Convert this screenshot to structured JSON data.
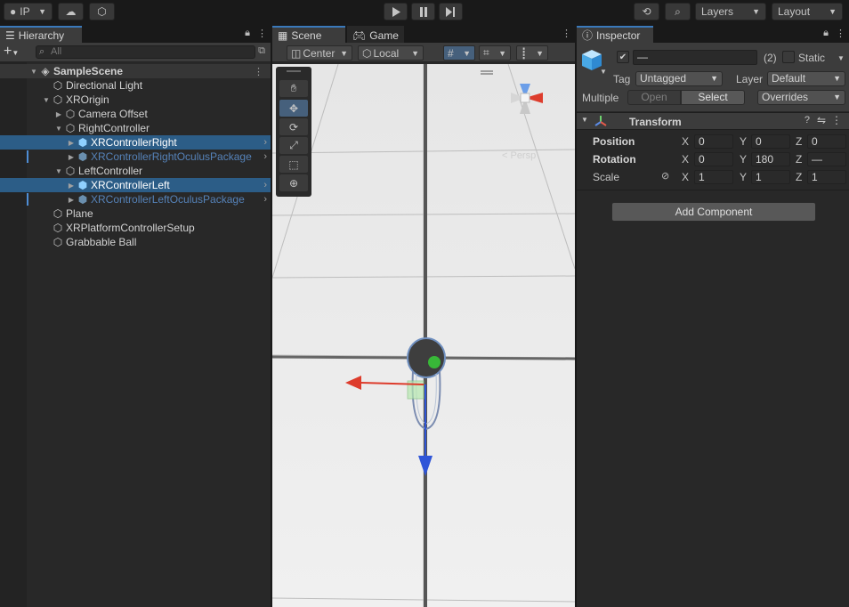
{
  "toolbar": {
    "account_label": "IP",
    "layers_label": "Layers",
    "layout_label": "Layout"
  },
  "hierarchy": {
    "tab_label": "Hierarchy",
    "search_placeholder": "All",
    "items": [
      {
        "label": "SampleScene"
      },
      {
        "label": "Directional Light"
      },
      {
        "label": "XROrigin"
      },
      {
        "label": "Camera Offset"
      },
      {
        "label": "RightController"
      },
      {
        "label": "XRControllerRight"
      },
      {
        "label": "XRControllerRightOculusPackage"
      },
      {
        "label": "LeftController"
      },
      {
        "label": "XRControllerLeft"
      },
      {
        "label": "XRControllerLeftOculusPackage"
      },
      {
        "label": "Plane"
      },
      {
        "label": "XRPlatformControllerSetup"
      },
      {
        "label": "Grabbable Ball"
      }
    ]
  },
  "scene": {
    "tab_scene": "Scene",
    "tab_game": "Game",
    "pivot_label": "Center",
    "space_label": "Local",
    "persp_label": "< Persp"
  },
  "inspector": {
    "tab_label": "Inspector",
    "name_value": "—",
    "count_label": "(2)",
    "static_label": "Static",
    "tag_label": "Tag",
    "tag_value": "Untagged",
    "layer_label": "Layer",
    "layer_value": "Default",
    "multiple_label": "Multiple",
    "open_label": "Open",
    "select_label": "Select",
    "overrides_label": "Overrides",
    "component_title": "Transform",
    "position_label": "Position",
    "rotation_label": "Rotation",
    "scale_label": "Scale",
    "axis_x": "X",
    "axis_y": "Y",
    "axis_z": "Z",
    "position": {
      "x": "0",
      "y": "0",
      "z": "0"
    },
    "rotation": {
      "x": "0",
      "y": "180",
      "z": "—"
    },
    "scale": {
      "x": "1",
      "y": "1",
      "z": "1"
    },
    "add_component_label": "Add Component"
  }
}
